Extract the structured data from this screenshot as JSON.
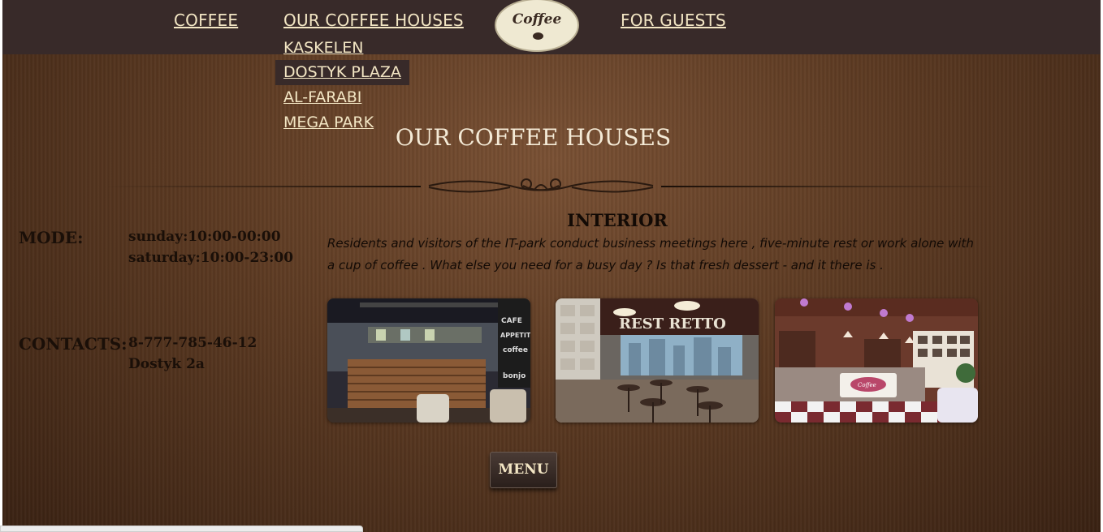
{
  "nav": {
    "coffee": "COFFEE",
    "coffee_houses": "OUR COFFEE HOUSES",
    "for_guests": "FOR GUESTS",
    "logo_text": "Coffee"
  },
  "dropdown": {
    "items": [
      "KASKELEN",
      "DOSTYK PLAZA",
      "AL-FARABI",
      "MEGA PARK"
    ],
    "active": "DOSTYK PLAZA"
  },
  "page": {
    "title": "OUR COFFEE HOUSES"
  },
  "mode": {
    "label": "MODE:",
    "hours": [
      "sunday:10:00-00:00",
      "saturday:10:00-23:00"
    ]
  },
  "contacts": {
    "label": "CONTACTS:",
    "phone": "8-777-785-46-12",
    "address": "Dostyk 2a"
  },
  "interior": {
    "title": "INTERIOR",
    "text": "Residents and visitors of the IT-park conduct business meetings here , five-minute rest or work alone with a cup of coffee . What else you need for a busy day ? Is that fresh dessert - and it there is .",
    "photos": [
      {
        "caption": ""
      },
      {
        "sign_text": "REST RETTO"
      },
      {
        "sign_text": "Coffee"
      }
    ]
  },
  "menu_button": "MENU",
  "colors": {
    "topbar": "#382a29",
    "nav_text": "#f3e6c4",
    "title_text": "#f4ead6",
    "body_text": "#1a0f08"
  }
}
